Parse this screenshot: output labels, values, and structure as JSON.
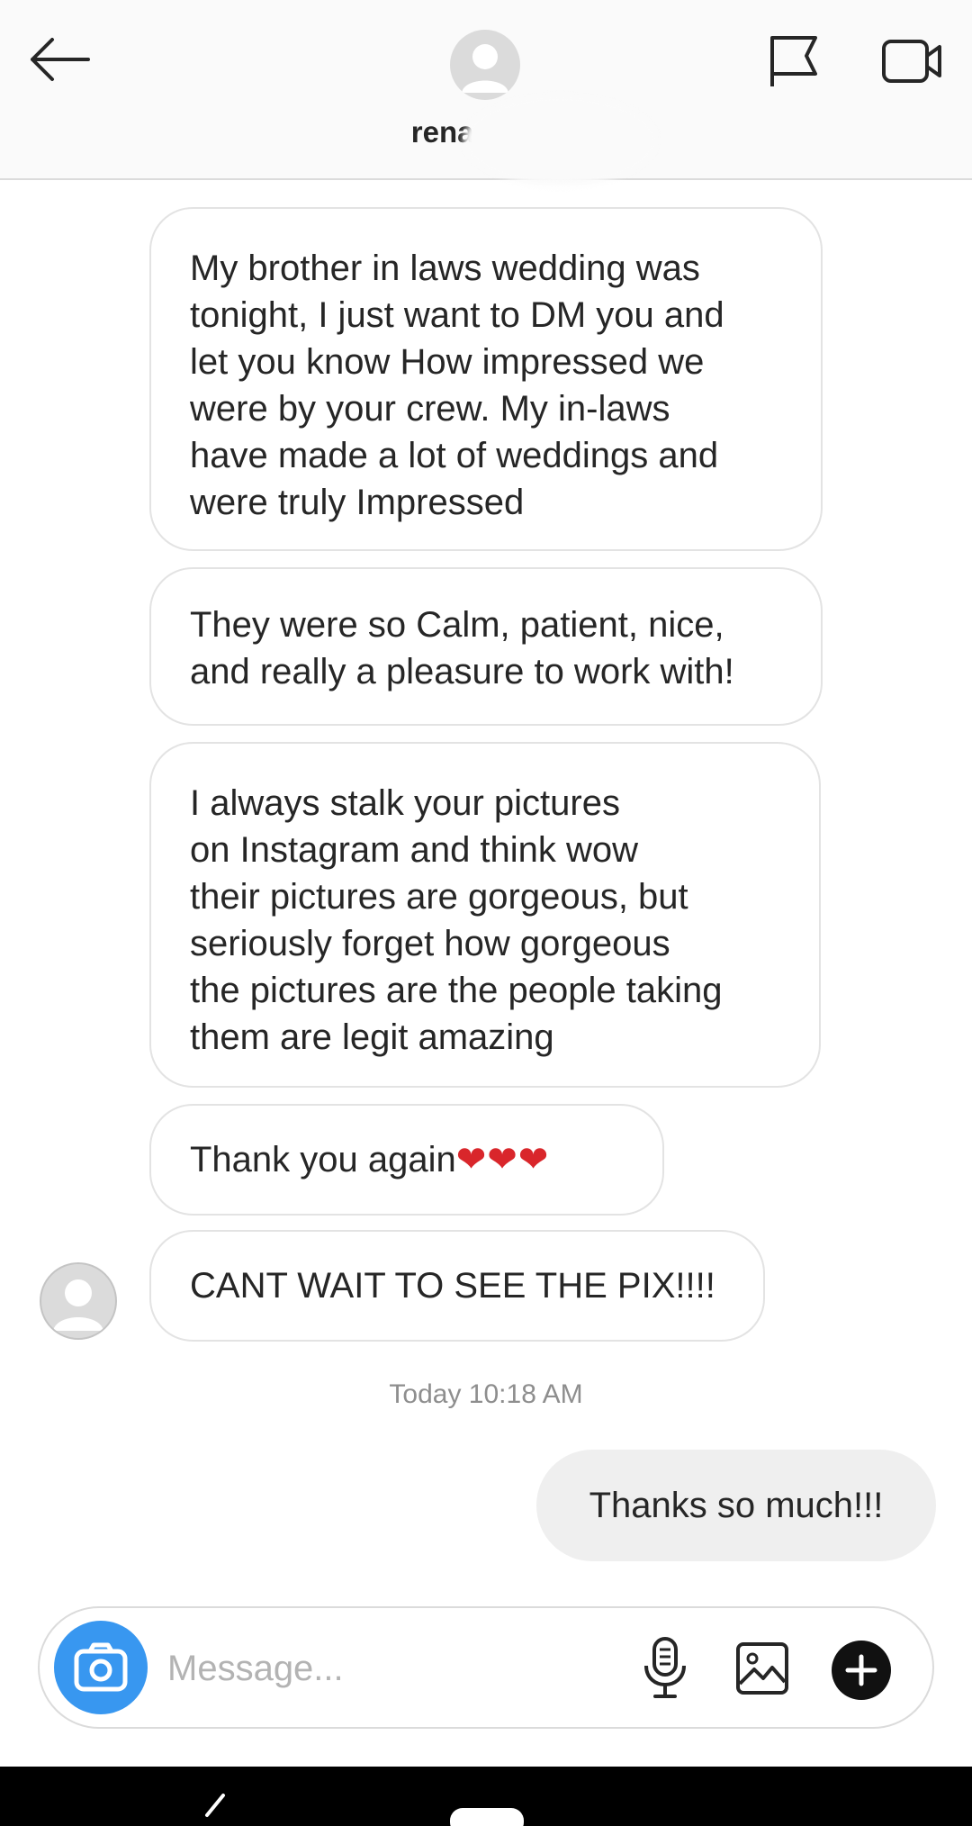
{
  "header": {
    "username": "rena_v",
    "back_icon": "arrow-left-icon",
    "flag_icon": "flag-icon",
    "video_icon": "video-call-icon"
  },
  "messages": {
    "incoming": [
      {
        "lines": [
          "My brother in laws wedding was",
          "tonight, I just want to DM you and",
          "let you know How impressed we",
          "were by your crew. My in-laws",
          "have made a lot of weddings and",
          "were truly Impressed"
        ]
      },
      {
        "lines": [
          "They were so Calm, patient, nice,",
          "and really a pleasure to work with!"
        ]
      },
      {
        "lines": [
          "I always stalk your pictures",
          "on Instagram and think wow",
          "their pictures are gorgeous, but",
          "seriously forget how gorgeous",
          "the pictures are the people taking",
          "them are legit amazing"
        ]
      },
      {
        "text": "Thank you again",
        "hearts": "❤❤❤"
      },
      {
        "text": "CANT WAIT TO SEE THE PIX!!!!"
      }
    ],
    "timestamp": "Today 10:18 AM",
    "outgoing": [
      {
        "text": "Thanks so much!!!"
      }
    ]
  },
  "composer": {
    "placeholder": "Message...",
    "camera_icon": "camera-icon",
    "mic_icon": "microphone-icon",
    "gallery_icon": "image-gallery-icon",
    "plus_icon": "plus-icon",
    "accent_color": "#3897f0"
  }
}
